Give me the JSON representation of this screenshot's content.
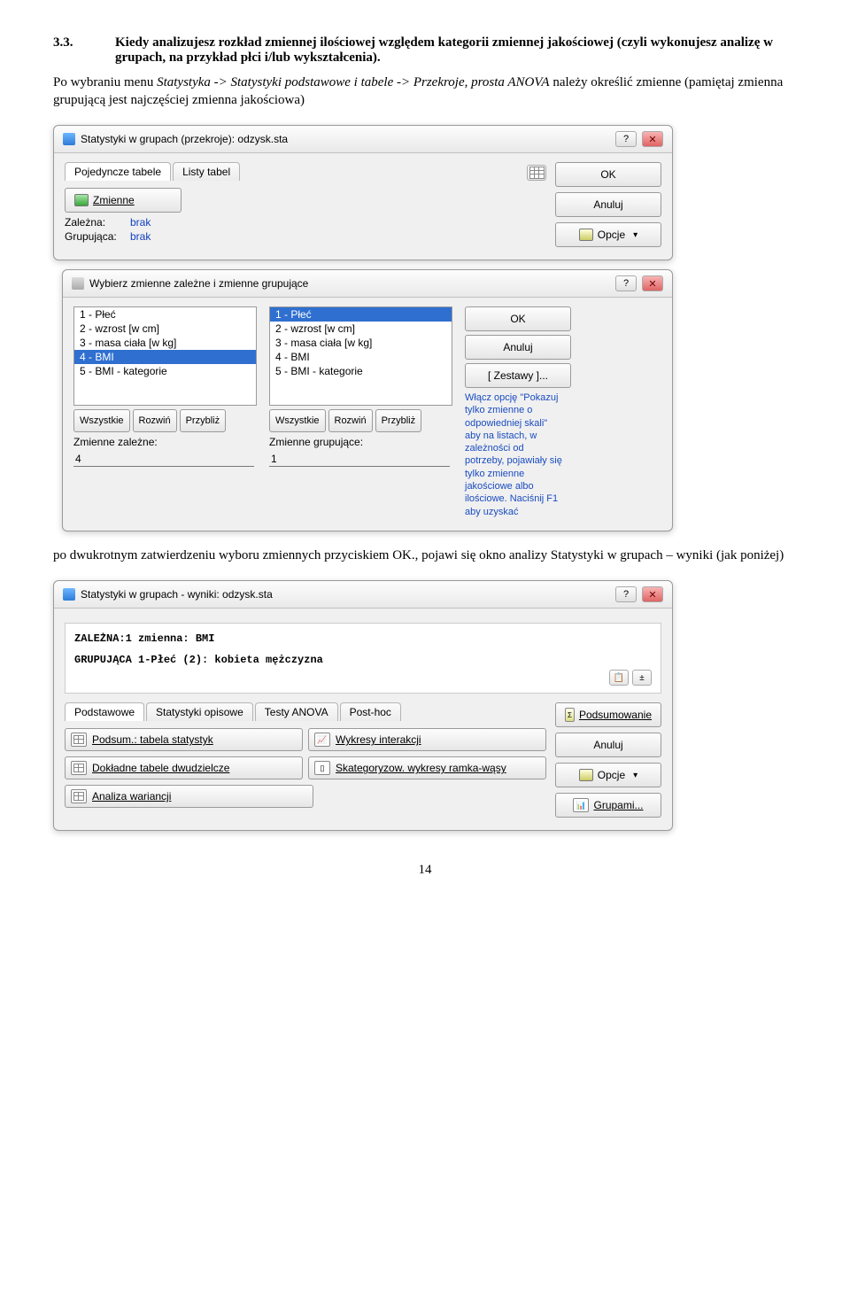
{
  "doc": {
    "section_num": "3.3.",
    "heading": "Kiedy analizujesz rozkład zmiennej ilościowej względem kategorii zmiennej jakościowej (czyli wykonujesz analizę w grupach, na przykład płci i/lub wykształcenia).",
    "para1_a": "Po wybraniu menu ",
    "para1_b": "Statystyka -> Statystyki podstawowe i tabele -> Przekroje, prosta ANOVA",
    "para1_c": " należy określić zmienne (pamiętaj zmienna grupującą jest najczęściej zmienna jakościowa)",
    "para2_a": "po dwukrotnym zatwierdzeniu wyboru zmiennych przyciskiem OK., pojawi się okno analizy Statystyki w grupach – wyniki (jak poniżej)",
    "page_number": "14"
  },
  "win1": {
    "title": "Statystyki w grupach (przekroje): odzysk.sta",
    "tab1": "Pojedyncze tabele",
    "tab2": "Listy tabel",
    "btn_zmienne": "Zmienne",
    "dep_label": "Zależna:",
    "dep_val": "brak",
    "grp_label": "Grupująca:",
    "grp_val": "brak",
    "ok": "OK",
    "cancel": "Anuluj",
    "options": "Opcje"
  },
  "win2": {
    "title": "Wybierz zmienne zależne i zmienne grupujące",
    "items": [
      "1 - Płeć",
      "2 - wzrost [w cm]",
      "3 - masa ciała [w kg]",
      "4 - BMI",
      "5 - BMI - kategorie"
    ],
    "ok": "OK",
    "cancel": "Anuluj",
    "sets": "[ Zestawy ]...",
    "hint": "Włącz opcję \"Pokazuj tylko zmienne o odpowiedniej skali\" aby na listach, w zależności od potrzeby, pojawiały się tylko zmienne jakościowe albo ilościowe. Naciśnij F1 aby uzyskać",
    "all": "Wszystkie",
    "expand": "Rozwiń",
    "zoom": "Przybliż",
    "dep_label": "Zmienne zależne:",
    "grp_label": "Zmienne grupujące:",
    "dep_val": "4",
    "grp_val": "1"
  },
  "win3": {
    "title": "Statystyki w grupach - wyniki: odzysk.sta",
    "line1": "ZALEŻNA:1 zmienna: BMI",
    "line2": "GRUPUJĄCA 1-Płeć    (2): kobieta mężczyzna",
    "tab1": "Podstawowe",
    "tab2": "Statystyki opisowe",
    "tab3": "Testy ANOVA",
    "tab4": "Post-hoc",
    "summary": "Podsumowanie",
    "cancel": "Anuluj",
    "options": "Opcje",
    "groups": "Grupami...",
    "b1": "Podsum.: tabela statystyk",
    "b2": "Wykresy interakcji",
    "b3": "Dokładne tabele dwudzielcze",
    "b4": "Skategoryzow. wykresy ramka-wąsy",
    "b5": "Analiza wariancji"
  }
}
